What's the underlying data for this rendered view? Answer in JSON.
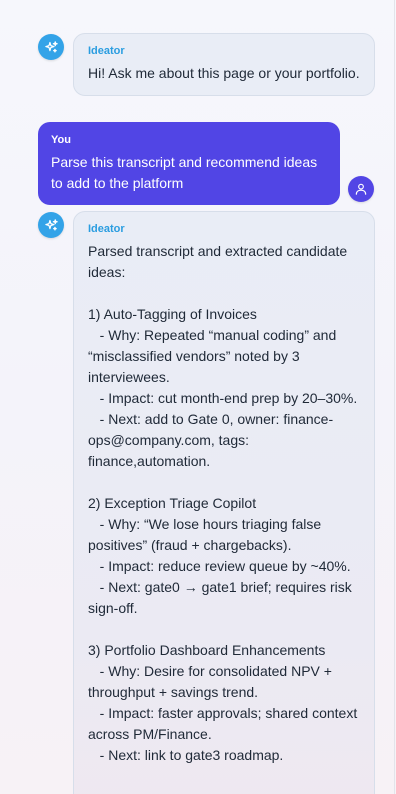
{
  "messages": [
    {
      "role": "assistant",
      "sender": "Ideator",
      "avatar_icon": "sparkle-icon",
      "text": "Hi! Ask me about this page or your portfolio."
    },
    {
      "role": "user",
      "sender": "You",
      "avatar_icon": "user-icon",
      "text": "Parse this transcript and recommend ideas to add to the platform"
    },
    {
      "role": "assistant",
      "sender": "Ideator",
      "avatar_icon": "sparkle-icon",
      "text": "Parsed transcript and extracted candidate ideas:\n\n1) Auto-Tagging of Invoices\n   - Why: Repeated “manual coding” and “misclassified vendors” noted by 3 interviewees.\n   - Impact: cut month-end prep by 20–30%.\n   - Next: add to Gate 0, owner: finance-ops@company.com, tags: finance,automation.\n\n2) Exception Triage Copilot\n   - Why: “We lose hours triaging false positives” (fraud + chargebacks).\n   - Impact: reduce review queue by ~40%.\n   - Next: gate0 → gate1 brief; requires risk sign-off.\n\n3) Portfolio Dashboard Enhancements\n   - Why: Desire for consolidated NPV + throughput + savings trend.\n   - Impact: faster approvals; shared context across PM/Finance.\n   - Next: link to gate3 roadmap."
    }
  ],
  "colors": {
    "assistant_accent": "#33a3e8",
    "user_accent": "#5145e5",
    "assistant_bubble": "#e9edf6"
  }
}
